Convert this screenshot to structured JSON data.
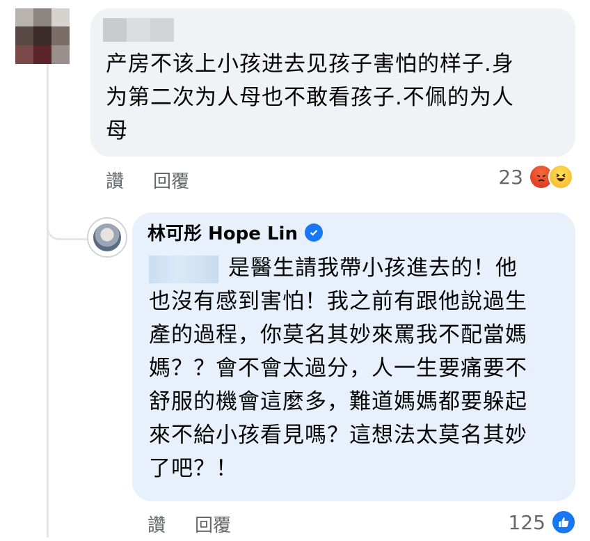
{
  "comment1": {
    "text": "产房不该上小孩进去见孩子害怕的样子.身\n为第二次为人母也不敢看孩子.不佩的为人\n母",
    "actions": {
      "like": "讚",
      "reply": "回覆"
    },
    "reaction_count": "23",
    "reactions": [
      "angry-icon",
      "haha-icon"
    ]
  },
  "comment2": {
    "author": "林可彤 Hope Lin",
    "verified": true,
    "text": "是醫生請我帶小孩進去的！他\n也沒有感到害怕！我之前有跟他說過生\n產的過程，你莫名其妙來罵我不配當媽\n媽？？會不會太過分，人一生要痛要不\n舒服的機會這麼多，難道媽媽都要躲起\n來不給小孩看見嗎？這想法太莫名其妙\n了吧？！",
    "actions": {
      "like": "讚",
      "reply": "回覆"
    },
    "reaction_count": "125",
    "reactions": [
      "like-icon"
    ]
  },
  "colors": {
    "bubble_gray": "#f0f2f5",
    "bubble_blue": "#e8f1fb",
    "secondary_text": "#65676b",
    "facebook_blue": "#1877f2"
  }
}
